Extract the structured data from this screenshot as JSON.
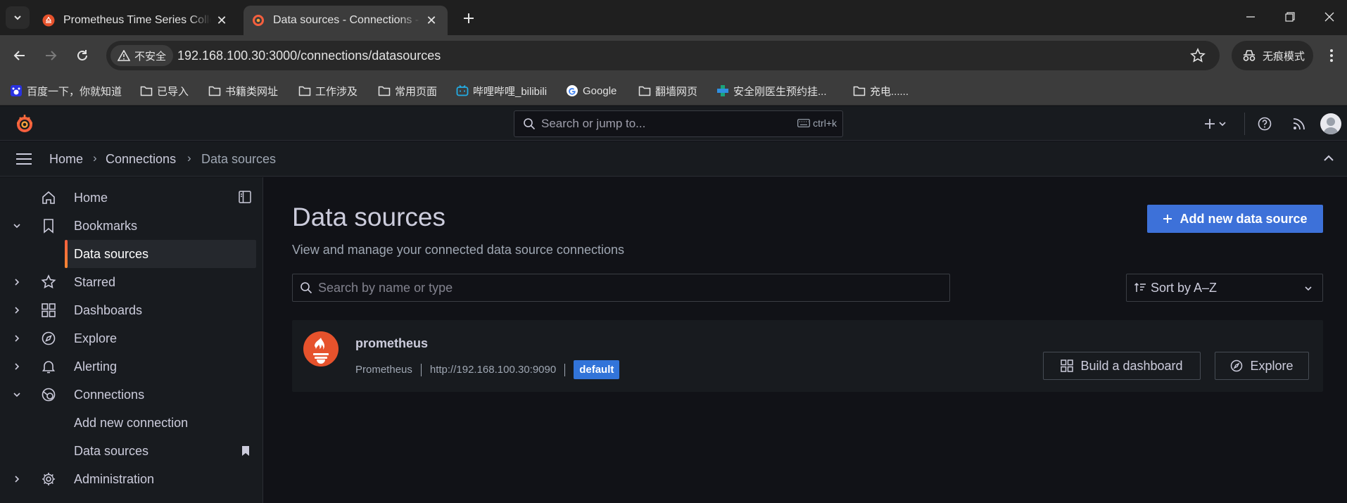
{
  "browser": {
    "tabs": [
      {
        "title": "Prometheus Time Series Collection"
      },
      {
        "title": "Data sources - Connections - Grafana"
      }
    ],
    "security_label": "不安全",
    "url": "192.168.100.30:3000/connections/datasources",
    "incognito_label": "无痕模式",
    "bookmarks": [
      {
        "label": "百度一下，你就知道"
      },
      {
        "label": "已导入"
      },
      {
        "label": "书籍类网址"
      },
      {
        "label": "工作涉及"
      },
      {
        "label": "常用页面"
      },
      {
        "label": "哔哩哔哩_bilibili"
      },
      {
        "label": "Google"
      },
      {
        "label": "翻墙网页"
      },
      {
        "label": "安全刚医生预约挂..."
      },
      {
        "label": "充电......"
      }
    ]
  },
  "header": {
    "search_placeholder": "Search or jump to...",
    "shortcut": "ctrl+k"
  },
  "breadcrumb": [
    "Home",
    "Connections",
    "Data sources"
  ],
  "sidebar": {
    "items": [
      {
        "label": "Home"
      },
      {
        "label": "Bookmarks"
      },
      {
        "label": "Data sources"
      },
      {
        "label": "Starred"
      },
      {
        "label": "Dashboards"
      },
      {
        "label": "Explore"
      },
      {
        "label": "Alerting"
      },
      {
        "label": "Connections"
      },
      {
        "label": "Add new connection"
      },
      {
        "label": "Data sources"
      },
      {
        "label": "Administration"
      }
    ]
  },
  "main": {
    "title": "Data sources",
    "subtitle": "View and manage your connected data source connections",
    "add_button": "Add new data source",
    "search_placeholder": "Search by name or type",
    "sort_label": "Sort by A–Z",
    "datasource": {
      "name": "prometheus",
      "type": "Prometheus",
      "url": "http://192.168.100.30:9090",
      "badge": "default",
      "build_button": "Build a dashboard",
      "explore_button": "Explore"
    }
  },
  "colors": {
    "accent_primary": "#3d71d9",
    "grafana_orange": "#f55f3e",
    "prometheus_red": "#e6522c"
  }
}
